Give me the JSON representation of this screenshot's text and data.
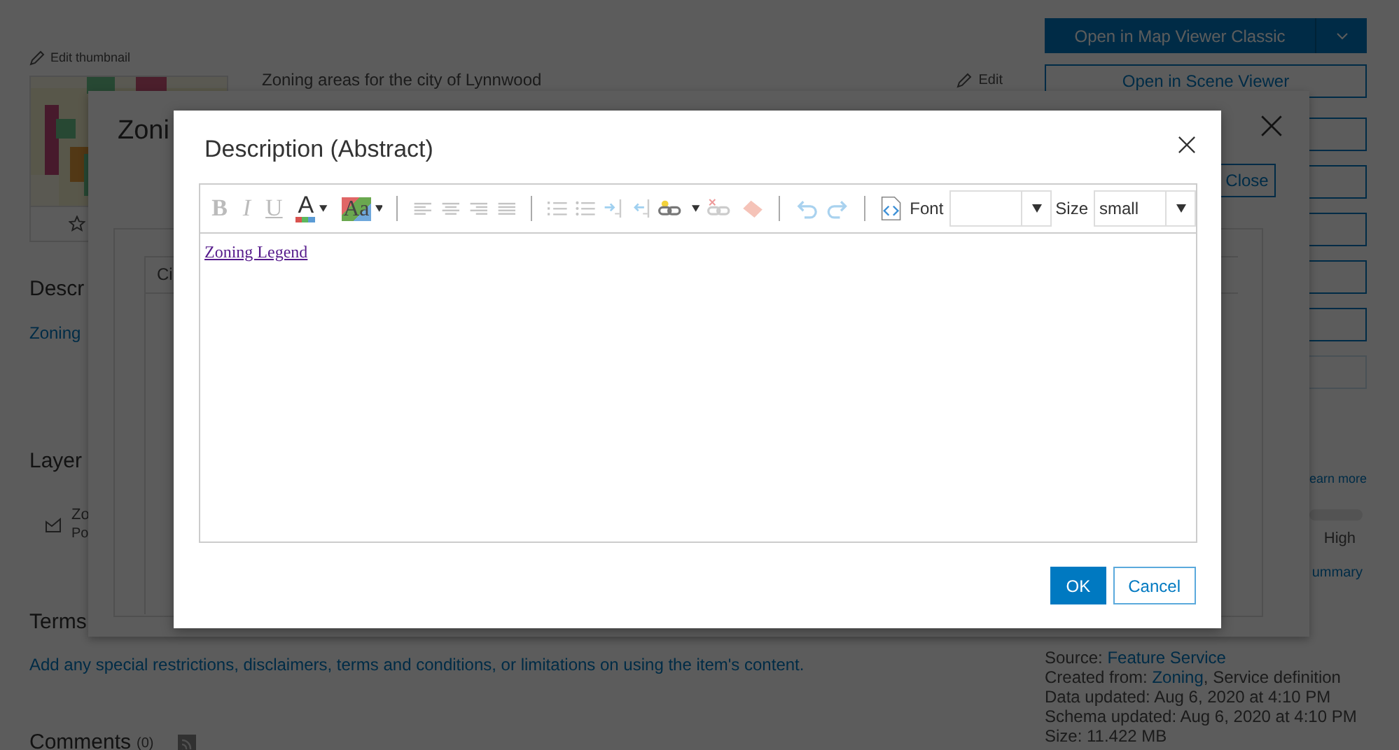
{
  "page": {
    "edit_thumbnail": "Edit thumbnail",
    "summary": "Zoning areas for the city of Lynnwood",
    "summary_edit": "Edit",
    "description": {
      "heading": "Descr",
      "link": "Zoning"
    },
    "layers": {
      "heading": "Layer",
      "items": [
        {
          "name": "Zo",
          "type": "Po"
        }
      ]
    },
    "terms": {
      "heading": "Terms",
      "link": "Add any special restrictions, disclaimers, terms and conditions, or limitations on using the item's content."
    },
    "comments": {
      "heading": "Comments",
      "count": "(0)"
    },
    "actions": {
      "primary": "Open in Map Viewer Classic",
      "secondary": "Open in Scene Viewer",
      "covered_buttons": [
        {
          "disabled": false
        },
        {
          "disabled": false
        },
        {
          "disabled": false
        },
        {
          "disabled": false
        },
        {
          "disabled": false
        },
        {
          "disabled": true
        }
      ]
    },
    "learn_more": "earn more",
    "slider_label": "High",
    "summary_link": "ummary",
    "details": [
      {
        "label": "Source: ",
        "link": "Feature Service"
      },
      {
        "label": "Created from: ",
        "link": "Zoning",
        "rest": ", Service definition"
      },
      {
        "label": "Data updated: ",
        "text": "Aug 6, 2020 at 4:10 PM"
      },
      {
        "label": "Schema updated: ",
        "text": "Aug 6, 2020 at 4:10 PM"
      },
      {
        "label": "Size: ",
        "text": "11.422 MB"
      }
    ]
  },
  "back_dialog": {
    "title": "Zoni",
    "close_button": "Close",
    "table_header": "Ci"
  },
  "dialog": {
    "title": "Description (Abstract)",
    "toolbar": {
      "style_buttons": [
        {
          "label": "B",
          "disabled": true
        },
        {
          "label": "I",
          "disabled": true
        },
        {
          "label": "U",
          "disabled": true
        }
      ],
      "color_button": "A",
      "highlight_button": "Aa",
      "font_label": "Font",
      "size_label": "Size",
      "size_value": "small"
    },
    "content_link": "Zoning Legend",
    "buttons": [
      {
        "label": "OK",
        "kind": "primary"
      },
      {
        "label": "Cancel",
        "kind": "secondary"
      }
    ]
  }
}
